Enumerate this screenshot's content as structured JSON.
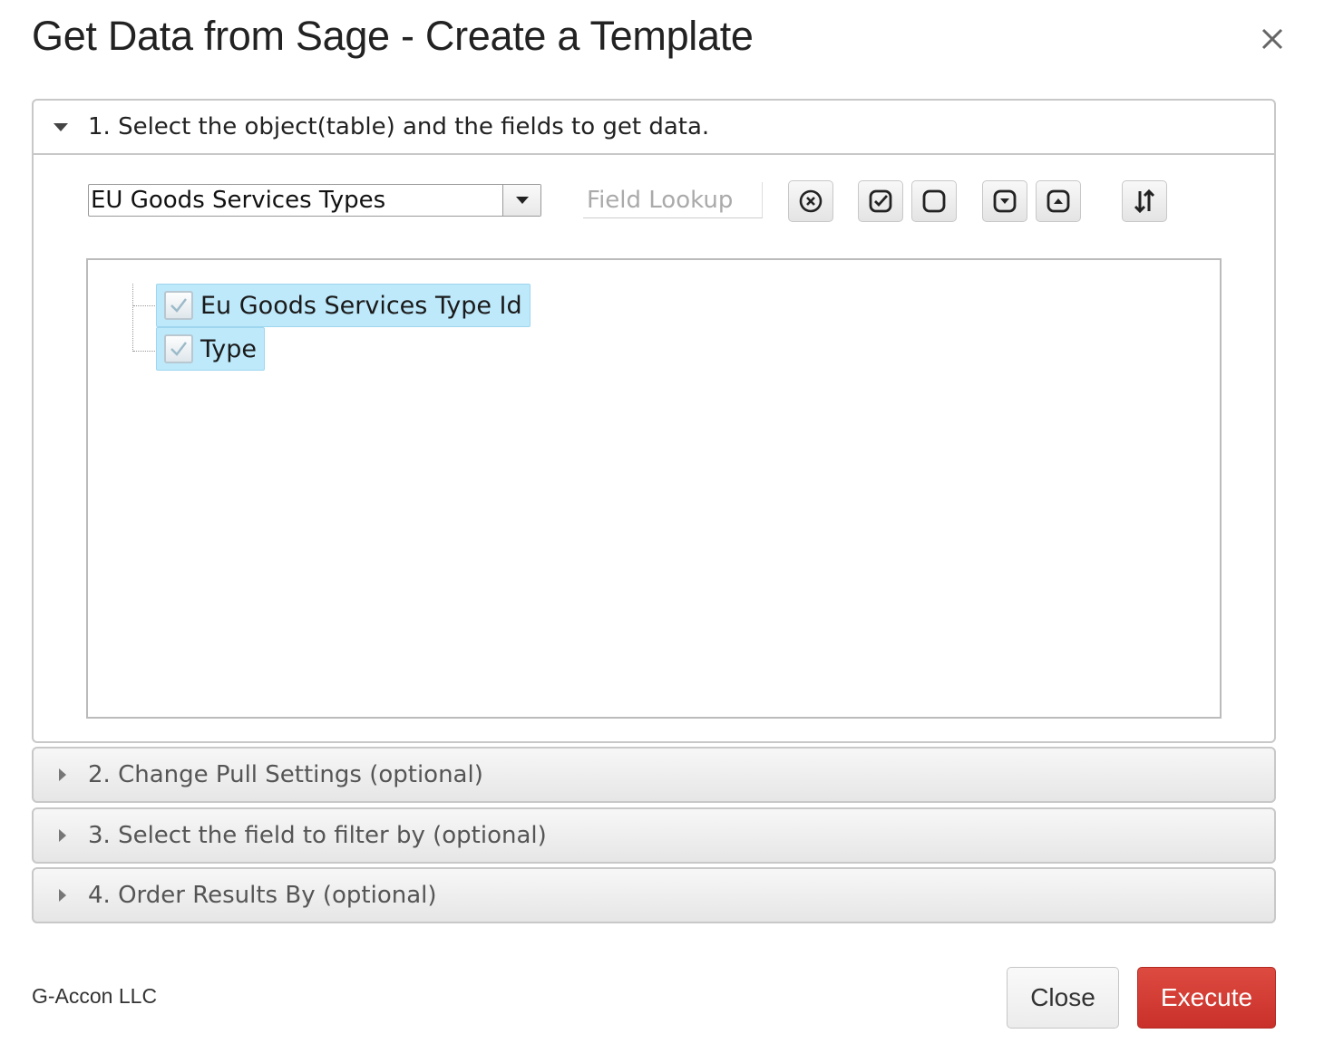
{
  "dialog": {
    "title": "Get Data from Sage - Create a Template",
    "close_icon": "close-icon"
  },
  "sections": [
    {
      "label": "1. Select the object(table) and the fields to get data.",
      "expanded": true
    },
    {
      "label": "2. Change Pull Settings (optional)",
      "expanded": false
    },
    {
      "label": "3. Select the field to filter by (optional)",
      "expanded": false
    },
    {
      "label": "4. Order Results By (optional)",
      "expanded": false
    }
  ],
  "object_select": {
    "value": "EU Goods Services Types"
  },
  "field_lookup": {
    "placeholder": "Field Lookup",
    "value": ""
  },
  "toolbar": {
    "icons": [
      "clear-circle-x-icon",
      "check-all-icon",
      "uncheck-all-icon",
      "expand-all-icon",
      "collapse-all-icon",
      "sort-icon"
    ]
  },
  "fields": [
    {
      "label": "Eu Goods Services Type Id",
      "checked": true
    },
    {
      "label": "Type",
      "checked": true
    }
  ],
  "footer": {
    "brand": "G-Accon LLC",
    "close_label": "Close",
    "execute_label": "Execute"
  },
  "colors": {
    "execute": "#d33c33",
    "selected_node": "#bde9fb"
  }
}
